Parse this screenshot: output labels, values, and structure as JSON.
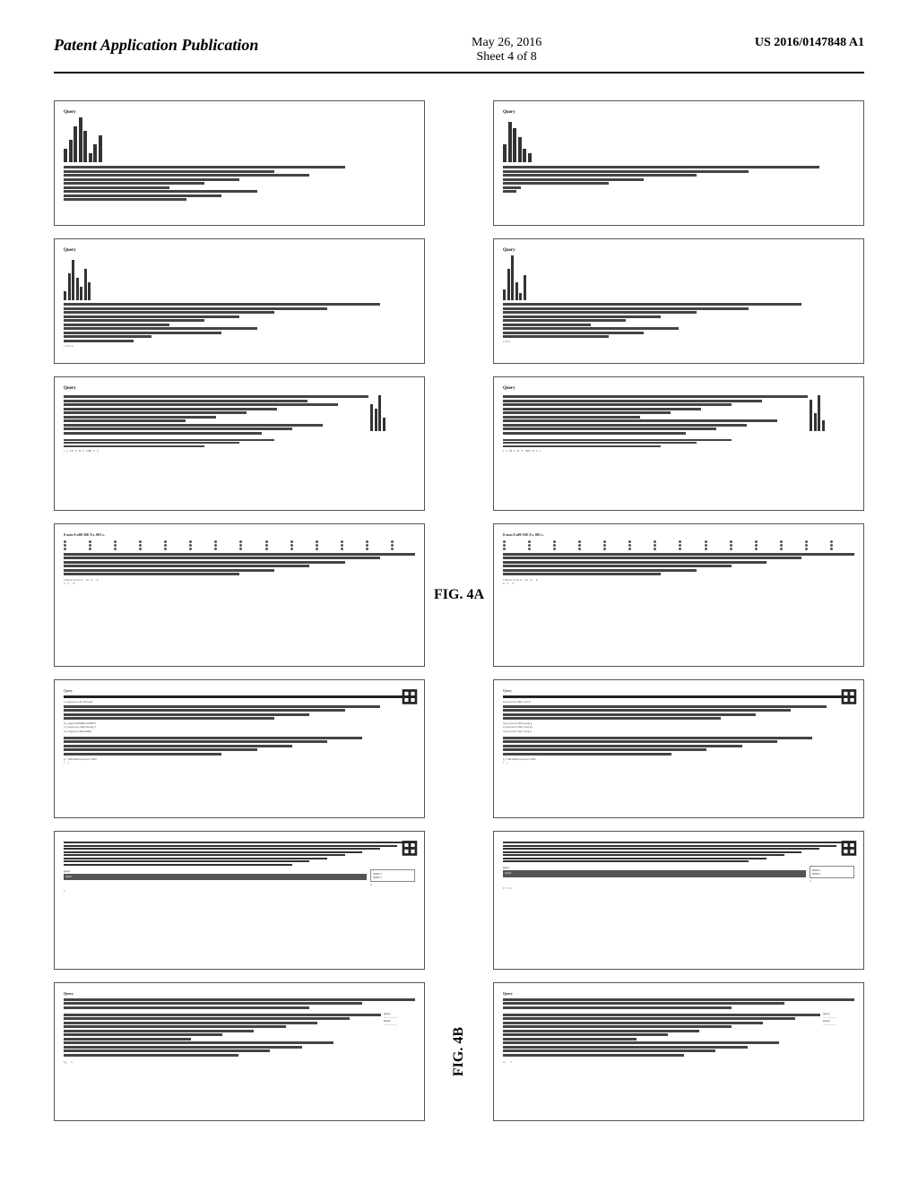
{
  "header": {
    "left": "Patent Application Publication",
    "center_line1": "May 26, 2016",
    "center_line2": "Sheet 4 of 8",
    "right": "US 2016/0147848 A1"
  },
  "fig_labels": {
    "fig4a": "FIG. 4A",
    "fig4b": "FIG. 4B"
  },
  "rows": [
    {
      "id": "row1",
      "has_fig": false
    },
    {
      "id": "row2",
      "has_fig": false
    },
    {
      "id": "row3",
      "has_fig": false
    },
    {
      "id": "row4",
      "has_fig": true,
      "fig_left": "FIG. 4A",
      "fig_right": "FIG. 4B"
    },
    {
      "id": "row5",
      "has_fig": false
    },
    {
      "id": "row6",
      "has_fig": false
    },
    {
      "id": "row7",
      "has_fig": false
    }
  ]
}
